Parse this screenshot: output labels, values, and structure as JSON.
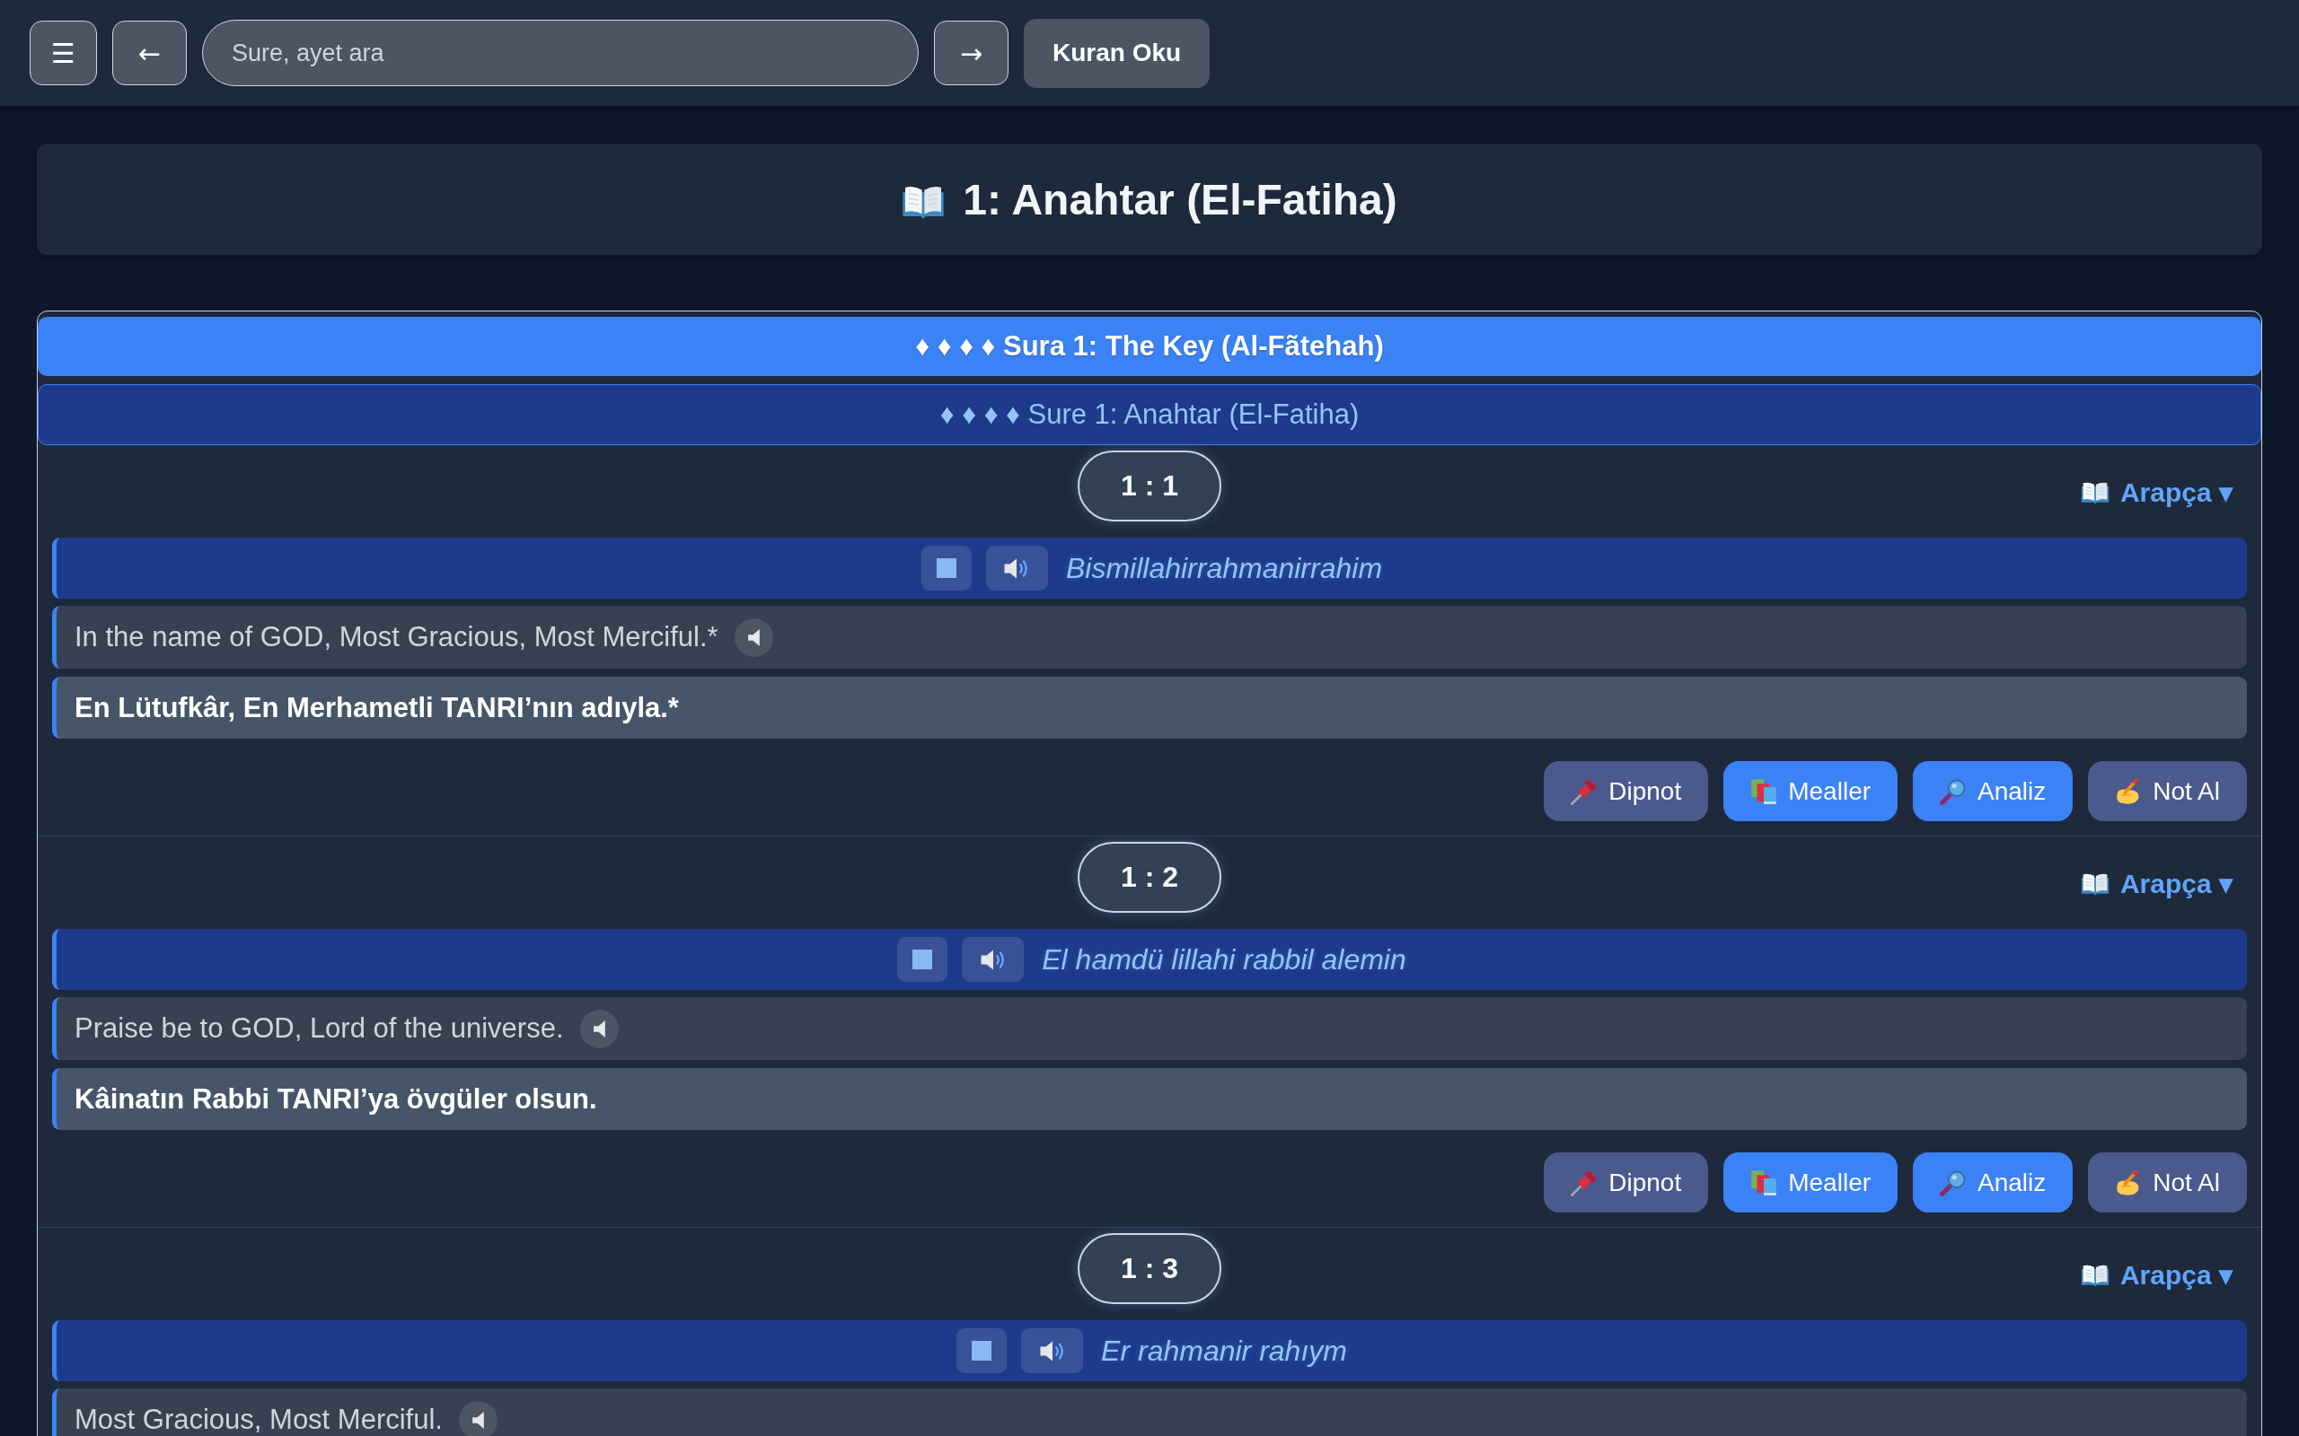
{
  "toolbar": {
    "menu_button": "☰",
    "back_button": "←",
    "search": {
      "placeholder": "Sure, ayet ara"
    },
    "forward_button": "→",
    "read_button": "Kuran Oku"
  },
  "title": "1: Anahtar (El-Fatiha)",
  "sura_headers": [
    {
      "kind": "primary",
      "text": "♦ ♦ ♦ ♦ Sura 1: The Key (Al-Fãtehah)"
    },
    {
      "kind": "secondary",
      "text": "♦ ♦ ♦ ♦ Sure 1: Anahtar (El-Fatiha)"
    }
  ],
  "verses": [
    {
      "number": "1 : 1",
      "language": "Arapça ▾",
      "transliteration": "Bismillahirrahmanirrahim",
      "translation_en": "In the name of GOD, Most Gracious, Most Merciful.*",
      "translation_tr": "En Lütufkâr, En Merhametli TANRI’nın adıyla.*",
      "actions": [
        {
          "label": "Dipnot",
          "kind": "footnote"
        },
        {
          "label": "Mealler",
          "kind": "translations"
        },
        {
          "label": "Analiz",
          "kind": "analysis"
        },
        {
          "label": "Not Al",
          "kind": "note"
        }
      ]
    },
    {
      "number": "1 : 2",
      "language": "Arapça ▾",
      "transliteration": "El hamdü lillahi rabbil alemin",
      "translation_en": "Praise be to GOD, Lord of the universe.",
      "translation_tr": "Kâinatın Rabbi TANRI’ya övgüler olsun.",
      "actions": [
        {
          "label": "Dipnot",
          "kind": "footnote"
        },
        {
          "label": "Mealler",
          "kind": "translations"
        },
        {
          "label": "Analiz",
          "kind": "analysis"
        },
        {
          "label": "Not Al",
          "kind": "note"
        }
      ]
    },
    {
      "number": "1 : 3",
      "language": "Arapça ▾",
      "transliteration": "Er rahmanir rahıym",
      "translation_en": "Most Gracious, Most Merciful."
    }
  ]
}
